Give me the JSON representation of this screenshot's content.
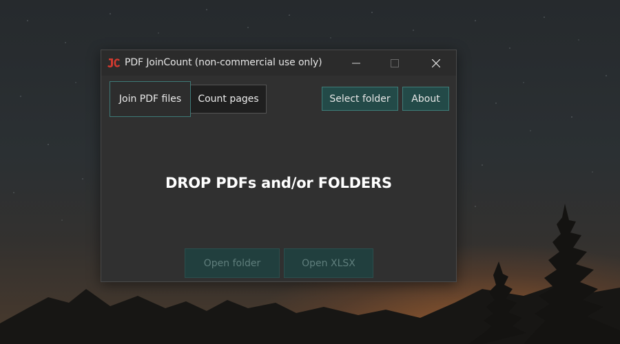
{
  "window": {
    "title": "PDF JoinCount (non-commercial use only)",
    "controls": {
      "minimize": "minimize-icon",
      "maximize": "maximize-icon",
      "close": "close-icon"
    }
  },
  "tabs": [
    {
      "label": "Join PDF files",
      "selected": true
    },
    {
      "label": "Count pages",
      "selected": false
    }
  ],
  "toolbar": {
    "select_folder_label": "Select folder",
    "about_label": "About"
  },
  "drop_zone": {
    "text": "DROP PDFs and/or FOLDERS"
  },
  "footer": {
    "open_folder_label": "Open folder",
    "open_xlsx_label": "Open XLSX",
    "enabled": false
  },
  "colors": {
    "accent": "#3f7d79",
    "button_fill": "#234a48",
    "window_bg": "#303030",
    "logo_red": "#d23a2f"
  }
}
